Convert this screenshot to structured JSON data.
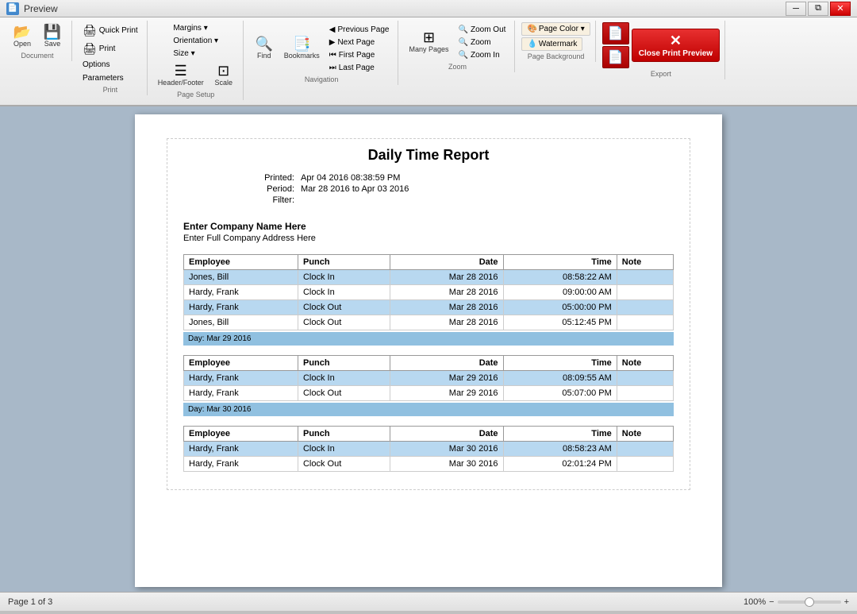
{
  "titlebar": {
    "title": "Preview",
    "icon": "📄"
  },
  "ribbon": {
    "groups": {
      "document": {
        "label": "Document",
        "buttons": [
          {
            "id": "open",
            "label": "Open",
            "icon": "📂"
          },
          {
            "id": "save",
            "label": "Save",
            "icon": "💾"
          }
        ]
      },
      "print": {
        "label": "Print",
        "buttons": [
          {
            "id": "quick-print",
            "label": "Quick Print",
            "icon": "🖨"
          },
          {
            "id": "print",
            "label": "Print",
            "icon": "🖨"
          },
          {
            "id": "options",
            "label": "Options",
            "icon": ""
          },
          {
            "id": "parameters",
            "label": "Parameters",
            "icon": ""
          }
        ]
      },
      "page_setup": {
        "label": "Page Setup",
        "buttons": [
          {
            "id": "margins",
            "label": "Margins ▾",
            "icon": ""
          },
          {
            "id": "orientation",
            "label": "Orientation ▾",
            "icon": ""
          },
          {
            "id": "size",
            "label": "Size ▾",
            "icon": ""
          },
          {
            "id": "header-footer",
            "label": "Header/Footer",
            "icon": ""
          },
          {
            "id": "scale",
            "label": "Scale",
            "icon": ""
          }
        ]
      },
      "navigation": {
        "label": "Navigation",
        "buttons": [
          {
            "id": "find",
            "label": "Find",
            "icon": "🔍"
          },
          {
            "id": "bookmarks",
            "label": "Bookmarks",
            "icon": "📑"
          },
          {
            "id": "previous-page",
            "label": "Previous Page",
            "icon": "◀"
          },
          {
            "id": "next-page",
            "label": "Next Page",
            "icon": "▶"
          },
          {
            "id": "first-page",
            "label": "First Page",
            "icon": "⏮"
          },
          {
            "id": "last-page",
            "label": "Last Page",
            "icon": "⏭"
          }
        ]
      },
      "zoom": {
        "label": "Zoom",
        "buttons": [
          {
            "id": "many-pages",
            "label": "Many Pages",
            "icon": "⊞"
          },
          {
            "id": "zoom-out",
            "label": "Zoom Out",
            "icon": "🔍"
          },
          {
            "id": "zoom",
            "label": "Zoom",
            "icon": "🔍"
          },
          {
            "id": "zoom-in",
            "label": "Zoom In",
            "icon": "🔍"
          }
        ]
      },
      "page_background": {
        "label": "Page Background",
        "buttons": [
          {
            "id": "page-color",
            "label": "Page Color ▾",
            "icon": ""
          },
          {
            "id": "watermark",
            "label": "Watermark",
            "icon": ""
          }
        ]
      },
      "export": {
        "label": "Export",
        "buttons": [
          {
            "id": "pdf1",
            "label": "PDF",
            "icon": ""
          },
          {
            "id": "pdf2",
            "label": "PDF",
            "icon": ""
          },
          {
            "id": "close-print-preview",
            "label": "Close Print Preview",
            "icon": "✕"
          }
        ]
      }
    }
  },
  "report": {
    "title": "Daily Time Report",
    "printed_label": "Printed:",
    "printed_value": "Apr 04 2016 08:38:59 PM",
    "period_label": "Period:",
    "period_value": "Mar 28 2016 to Apr 03 2016",
    "filter_label": "Filter:",
    "filter_value": "",
    "company_name": "Enter Company Name Here",
    "company_address": "Enter Full Company Address Here",
    "sections": [
      {
        "header": "",
        "table_headers": [
          "Employee",
          "Punch",
          "Date",
          "Time",
          "Note"
        ],
        "rows": [
          {
            "highlight": true,
            "employee": "Jones, Bill",
            "punch": "Clock In",
            "date": "Mar 28 2016",
            "time": "08:58:22 AM",
            "note": ""
          },
          {
            "highlight": false,
            "employee": "Hardy, Frank",
            "punch": "Clock In",
            "date": "Mar 28 2016",
            "time": "09:00:00 AM",
            "note": ""
          },
          {
            "highlight": true,
            "employee": "Hardy, Frank",
            "punch": "Clock Out",
            "date": "Mar 28 2016",
            "time": "05:00:00 PM",
            "note": ""
          },
          {
            "highlight": false,
            "employee": "Jones, Bill",
            "punch": "Clock Out",
            "date": "Mar 28 2016",
            "time": "05:12:45 PM",
            "note": ""
          }
        ],
        "day_summary": "Day: Mar 29 2016"
      },
      {
        "header": "",
        "table_headers": [
          "Employee",
          "Punch",
          "Date",
          "Time",
          "Note"
        ],
        "rows": [
          {
            "highlight": true,
            "employee": "Hardy, Frank",
            "punch": "Clock In",
            "date": "Mar 29 2016",
            "time": "08:09:55 AM",
            "note": ""
          },
          {
            "highlight": false,
            "employee": "Hardy, Frank",
            "punch": "Clock Out",
            "date": "Mar 29 2016",
            "time": "05:07:00 PM",
            "note": ""
          }
        ],
        "day_summary": "Day: Mar 30 2016"
      },
      {
        "header": "",
        "table_headers": [
          "Employee",
          "Punch",
          "Date",
          "Time",
          "Note"
        ],
        "rows": [
          {
            "highlight": true,
            "employee": "Hardy, Frank",
            "punch": "Clock In",
            "date": "Mar 30 2016",
            "time": "08:58:23 AM",
            "note": ""
          },
          {
            "highlight": false,
            "employee": "Hardy, Frank",
            "punch": "Clock Out",
            "date": "Mar 30 2016",
            "time": "02:01:24 PM",
            "note": ""
          }
        ],
        "day_summary": ""
      }
    ]
  },
  "statusbar": {
    "page_info": "Page 1 of 3",
    "zoom_level": "100%"
  }
}
